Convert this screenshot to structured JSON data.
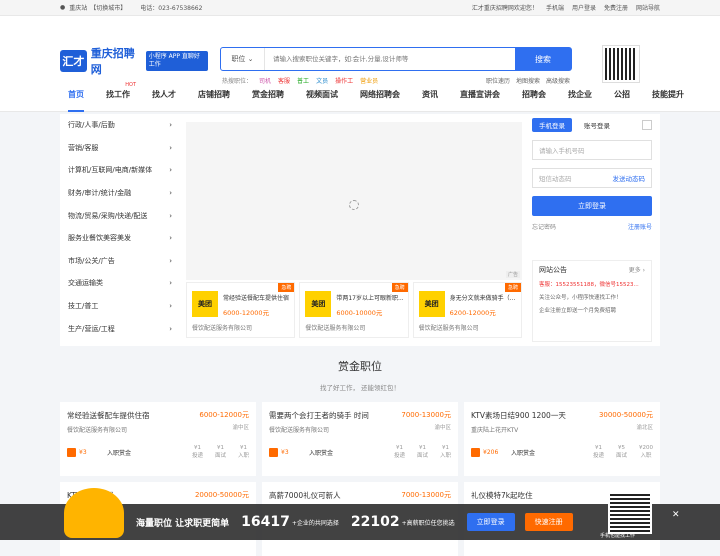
{
  "topbar": {
    "city": "重庆站",
    "switch": "【切换城市】",
    "phone": "电话：023-67538662",
    "welcome": "汇才重庆招聘网欢迎您！",
    "mobile": "手机端",
    "user_login": "用户登录",
    "register": "免费注册",
    "site_nav": "网站导航"
  },
  "logo": {
    "mark": "汇才",
    "name": "重庆招聘网",
    "app": "小程序 APP 直聊好工作"
  },
  "search": {
    "category": "职位",
    "placeholder": "请输入搜索职位关键字，如:会计,分量,设计师等",
    "button": "搜索"
  },
  "hot": {
    "label": "热搜职位：",
    "items": [
      "司机",
      "客服",
      "普工",
      "文员",
      "操作工",
      "营业员"
    ]
  },
  "sublinks": [
    "职位速历",
    "地图搜索",
    "高级搜索"
  ],
  "nav": {
    "items": [
      "首页",
      "找工作",
      "找人才",
      "店铺招聘",
      "赏金招聘",
      "视频面试",
      "网络招聘会",
      "资讯",
      "直播宣讲会",
      "招聘会",
      "找企业",
      "公招",
      "技能提升"
    ],
    "hot": "HOT"
  },
  "categories": [
    "行政/人事/后勤",
    "营销/客服",
    "计算机/互联网/电商/新媒体",
    "财务/审计/统计/金融",
    "物流/贸易/采购/快递/配送",
    "服务业餐饮美容美发",
    "市场/公关/广告",
    "交通运输类",
    "技工/普工",
    "生产/营运/工程"
  ],
  "banner_ad": "广告",
  "featured": [
    {
      "logo": "美团",
      "tag": "急聘",
      "title": "常经验送餐配车提供住宿",
      "salary": "6000-12000元",
      "company": "餐饮配送服务有限公司"
    },
    {
      "logo": "美团",
      "tag": "急聘",
      "title": "带两17岁以上可眼新职...",
      "salary": "6000-10000元",
      "company": "餐饮配送服务有限公司"
    },
    {
      "logo": "美团",
      "tag": "急聘",
      "title": "身无分文就来做骑手（...",
      "salary": "6200-12000元",
      "company": "餐饮配送服务有限公司"
    }
  ],
  "login": {
    "tab_phone": "手机登录",
    "tab_account": "账号登录",
    "phone_placeholder": "请输入手机号码",
    "sms_placeholder": "短信动态码",
    "send_code": "发送动态码",
    "button": "立即登录",
    "forgot": "忘记密码",
    "register": "注册账号"
  },
  "notice": {
    "title": "网站公告",
    "more": "更多 ›",
    "items": [
      "客服：15523551188，微信号15523...",
      "关注公众号，小程序快速找工作！",
      "企业注册立即送一个月免费招聘"
    ]
  },
  "section": {
    "title": "赏金职位",
    "subtitle": "找了好工作， 还能领红包！"
  },
  "jobs": [
    {
      "title": "常经验送餐配车提供住宿",
      "salary": "6000-12000元",
      "company": "餐饮配送服务有限公司",
      "location": "渝中区",
      "reward": "¥3",
      "reward_label": "入职赏金",
      "stats": [
        [
          "¥1",
          "投递"
        ],
        [
          "¥1",
          "面试"
        ],
        [
          "¥1",
          "入职"
        ]
      ]
    },
    {
      "title": "需要两个会打王者的骑手 时间",
      "salary": "7000-13000元",
      "company": "餐饮配送服务有限公司",
      "location": "渝中区",
      "reward": "¥3",
      "reward_label": "入职赏金",
      "stats": [
        [
          "¥1",
          "投递"
        ],
        [
          "¥1",
          "面试"
        ],
        [
          "¥1",
          "入职"
        ]
      ]
    },
    {
      "title": "KTV素场日结900 1200一天",
      "salary": "30000-50000元",
      "company": "重庆陆上花开KTV",
      "location": "渝北区",
      "reward": "¥206",
      "reward_label": "入职赏金",
      "stats": [
        [
          "¥1",
          "投递"
        ],
        [
          "¥5",
          "面试"
        ],
        [
          "¥200",
          "入职"
        ]
      ]
    },
    {
      "title": "KTV 酒水促销",
      "salary": "20000-50000元",
      "company": "",
      "location": "",
      "reward": "",
      "reward_label": "",
      "stats": []
    },
    {
      "title": "高薪7000礼仪可新人",
      "salary": "7000-13000元",
      "company": "",
      "location": "",
      "reward": "",
      "reward_label": "",
      "stats": []
    },
    {
      "title": "礼仪模特7k起吃住",
      "salary": "",
      "company": "",
      "location": "",
      "reward": "",
      "reward_label": "",
      "stats": []
    }
  ],
  "bottom": {
    "text": "海量职位 让求职更简单",
    "count1": "16417",
    "count1_label": "+企业的共同选择",
    "count2": "22102",
    "count2_label": "+高薪职位任您挑选",
    "login": "立即登录",
    "register": "快速注册",
    "qr_text": "手机也能找工作",
    "close": "✕"
  }
}
